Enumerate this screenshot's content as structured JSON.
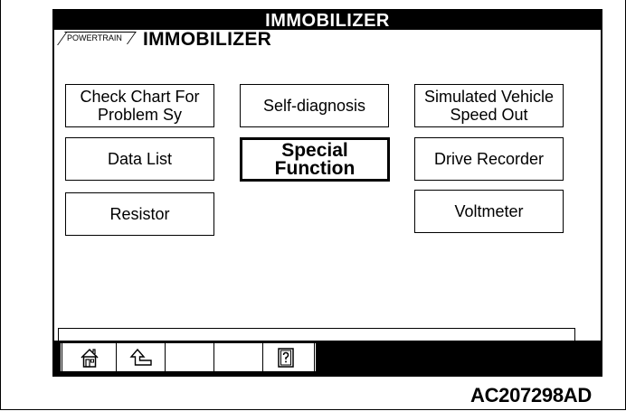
{
  "header": {
    "title": "IMMOBILIZER"
  },
  "breadcrumb": {
    "parent": "POWERTRAIN",
    "current": "IMMOBILIZER"
  },
  "functions": {
    "check_chart": "Check Chart For\nProblem Sy",
    "self_diagnosis": "Self-diagnosis",
    "simulated_speed": "Simulated Vehicle\nSpeed Out",
    "data_list": "Data List",
    "special_function": "Special\nFunction",
    "drive_recorder": "Drive Recorder",
    "resistor": "Resistor",
    "voltmeter": "Voltmeter"
  },
  "toolbar": {
    "icons": [
      "home-icon",
      "back-arrow-icon",
      "help-book-icon"
    ]
  },
  "figure": {
    "code": "AC207298AD"
  }
}
